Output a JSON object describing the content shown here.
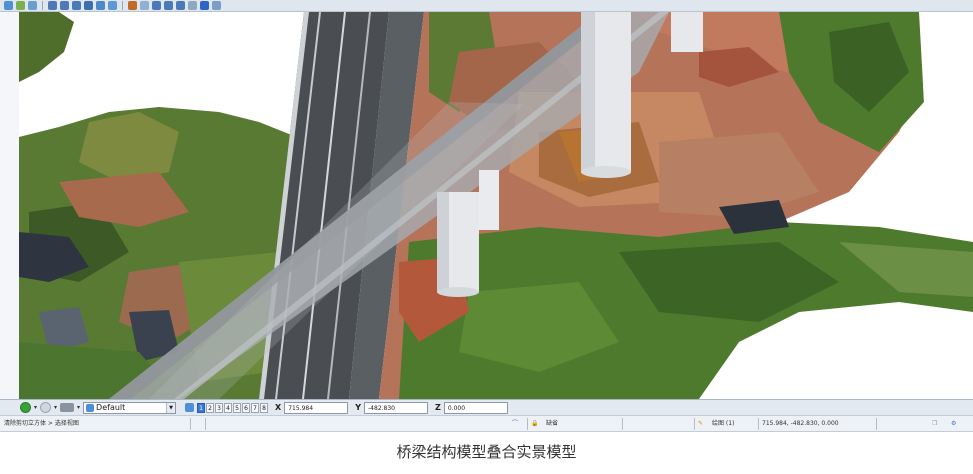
{
  "view": {
    "style_name": "Default",
    "view_buttons": [
      "1",
      "2",
      "3",
      "4",
      "5",
      "6",
      "7",
      "8"
    ],
    "active_view": "1"
  },
  "coords": {
    "x_label": "X",
    "x_value": "715.984",
    "y_label": "Y",
    "y_value": "-482.830",
    "z_label": "Z",
    "z_value": "0.000"
  },
  "status": {
    "prompt": "清除剪切立方体 > 选择视图",
    "level": "缺省",
    "model": "绘图 (1)",
    "cursor_coords": "715.984, -482.830, 0.000"
  },
  "caption": "桥梁结构模型叠合实景模型",
  "colors": {
    "toolbar_bg": "#e3e9f0",
    "active_view": "#3a78d8",
    "pier": "#e4e6ea",
    "deck": "#9ea3a8",
    "road": "#44484d",
    "vegetation": "#4e7a2e",
    "soil": "#b06a4a"
  },
  "icons": [
    "gear-icon",
    "lock-icon",
    "nav-back-icon",
    "nav-forward-icon"
  ]
}
